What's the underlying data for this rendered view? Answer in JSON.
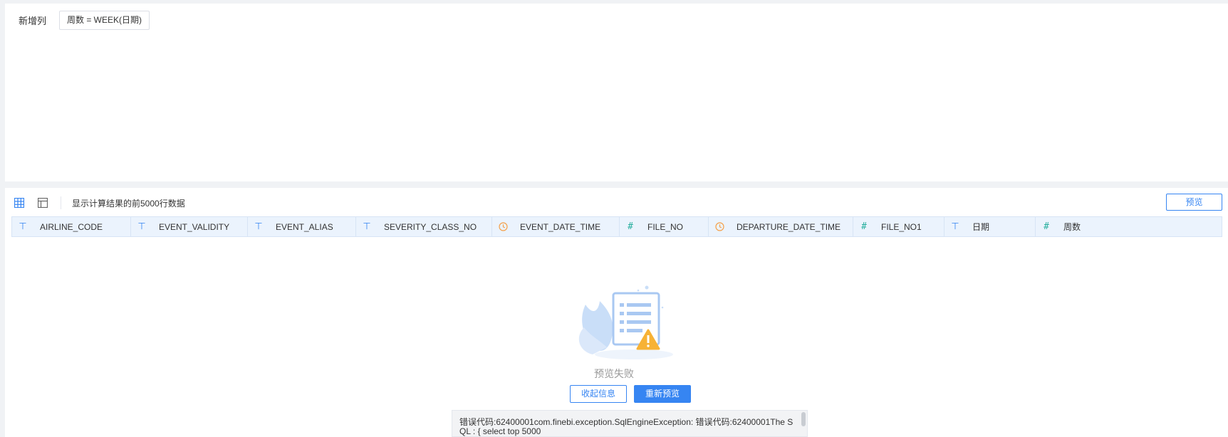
{
  "top_section": {
    "label": "新增列",
    "formula_tag": "周数 = WEEK(日期)"
  },
  "preview": {
    "toolbar_text": "显示计算结果的前5000行数据",
    "preview_button": "预览",
    "columns": [
      {
        "name": "AIRLINE_CODE",
        "type": "text",
        "icon": "text-type-icon"
      },
      {
        "name": "EVENT_VALIDITY",
        "type": "text",
        "icon": "text-type-icon"
      },
      {
        "name": "EVENT_ALIAS",
        "type": "text",
        "icon": "text-type-icon"
      },
      {
        "name": "SEVERITY_CLASS_NO",
        "type": "text",
        "icon": "text-type-icon"
      },
      {
        "name": "EVENT_DATE_TIME",
        "type": "date",
        "icon": "clock-icon"
      },
      {
        "name": "FILE_NO",
        "type": "number",
        "icon": "number-type-icon"
      },
      {
        "name": "DEPARTURE_DATE_TIME",
        "type": "date",
        "icon": "clock-icon"
      },
      {
        "name": "FILE_NO1",
        "type": "number",
        "icon": "number-type-icon"
      },
      {
        "name": "日期",
        "type": "text",
        "icon": "text-type-icon"
      },
      {
        "name": "周数",
        "type": "number",
        "icon": "number-type-icon"
      }
    ],
    "fail_text": "预览失败",
    "collapse_button": "收起信息",
    "retry_button": "重新预览",
    "error_lines": [
      "错误代码:62400001com.finebi.exception.SqlEngineException: 错误代码:62400001The S",
      "QL : {  select top 5000"
    ]
  },
  "colors": {
    "accent": "#3685f2",
    "header_bg": "#ebf3fd",
    "number_icon": "#2bb0a0",
    "date_icon": "#f5a04a",
    "warning": "#f7b236"
  }
}
